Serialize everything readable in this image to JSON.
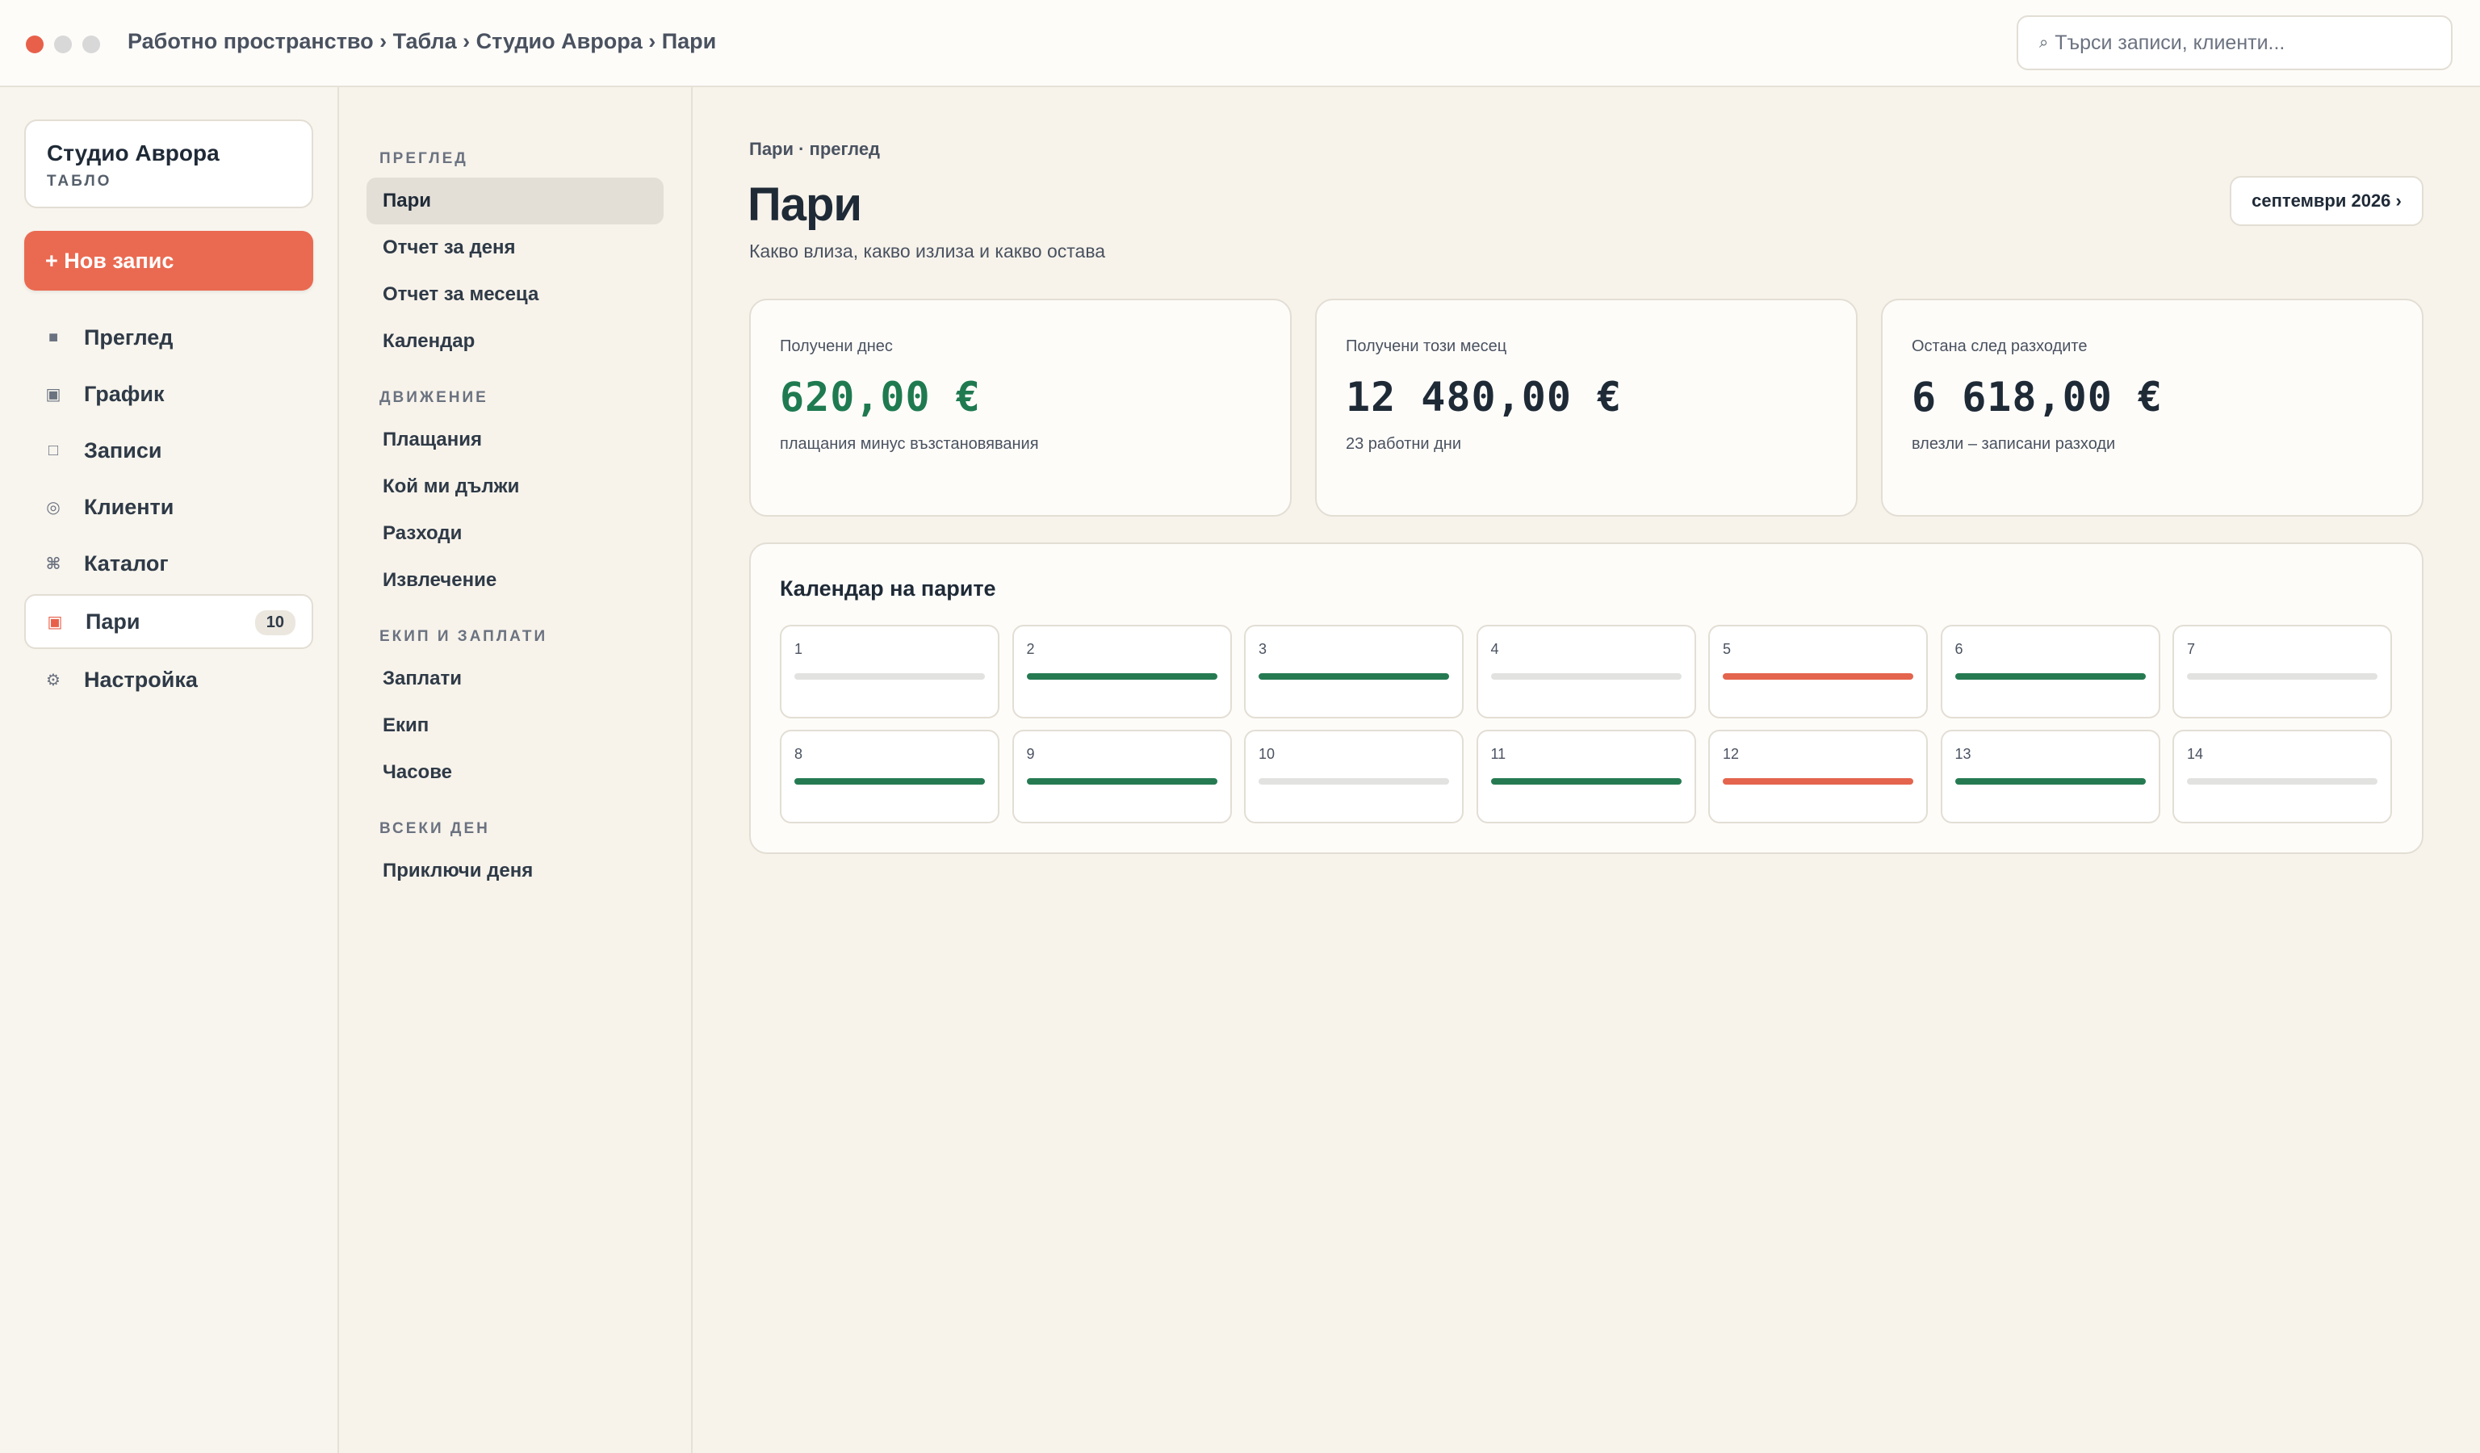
{
  "window": {
    "breadcrumb": "Работно пространство › Табла › Студио Аврора › Пари"
  },
  "search": {
    "icon": "search-icon",
    "placeholder": "Търси записи, клиенти..."
  },
  "sidebar": {
    "brand_name": "Студио Аврора",
    "brand_sub": "ТАБЛО",
    "new_button": "+ Нов запис",
    "items": [
      {
        "label": "Преглед",
        "icon": "square-icon",
        "glyph": "■"
      },
      {
        "label": "График",
        "icon": "schedule-icon",
        "glyph": "▣"
      },
      {
        "label": "Записи",
        "icon": "records-icon",
        "glyph": "□"
      },
      {
        "label": "Клиенти",
        "icon": "clients-icon",
        "glyph": "◎"
      },
      {
        "label": "Каталог",
        "icon": "catalog-icon",
        "glyph": "⌘"
      },
      {
        "label": "Пари",
        "icon": "money-icon",
        "glyph": "▣",
        "badge": "10",
        "active": true
      },
      {
        "label": "Настройка",
        "icon": "settings-icon",
        "glyph": "⚙"
      }
    ]
  },
  "subnav": {
    "sections": [
      {
        "title": "ПРЕГЛЕД",
        "items": [
          "Пари",
          "Отчет за деня",
          "Отчет за месеца",
          "Календар"
        ]
      },
      {
        "title": "ДВИЖЕНИЕ",
        "items": [
          "Плащания",
          "Кой ми дължи",
          "Разходи",
          "Извлечение"
        ]
      },
      {
        "title": "ЕКИП И ЗАПЛАТИ",
        "items": [
          "Заплати",
          "Екип",
          "Часове"
        ]
      },
      {
        "title": "ВСЕКИ ДЕН",
        "items": [
          "Приключи деня"
        ]
      }
    ],
    "active": "Пари"
  },
  "main": {
    "eyebrow": "Пари · преглед",
    "title": "Пари",
    "subtitle": "Какво влиза, какво излиза и какво остава",
    "month_button": "септември 2026 ›",
    "cards": [
      {
        "label": "Получени днес",
        "value": "620,00 €",
        "note": "плащания минус възстановявания"
      },
      {
        "label": "Получени този месец",
        "value": "12 480,00 €",
        "note": "23 работни дни"
      },
      {
        "label": "Остана след разходите",
        "value": "6 618,00 €",
        "note": "влезли – записани разходи"
      }
    ],
    "calendar": {
      "title": "Календар на парите",
      "days": [
        {
          "day": "1",
          "status": "none"
        },
        {
          "day": "2",
          "status": "paid"
        },
        {
          "day": "3",
          "status": "paid"
        },
        {
          "day": "4",
          "status": "none"
        },
        {
          "day": "5",
          "status": "owed"
        },
        {
          "day": "6",
          "status": "paid"
        },
        {
          "day": "7",
          "status": "none"
        },
        {
          "day": "8",
          "status": "paid"
        },
        {
          "day": "9",
          "status": "paid"
        },
        {
          "day": "10",
          "status": "none"
        },
        {
          "day": "11",
          "status": "paid"
        },
        {
          "day": "12",
          "status": "owed"
        },
        {
          "day": "13",
          "status": "paid"
        },
        {
          "day": "14",
          "status": "none"
        }
      ]
    }
  },
  "colors": {
    "accent": "#ea6a51",
    "positive": "#1f7a50",
    "paid_bar": "#267a52",
    "owed_bar": "#e4644d",
    "empty_bar": "#e2e3e1"
  }
}
